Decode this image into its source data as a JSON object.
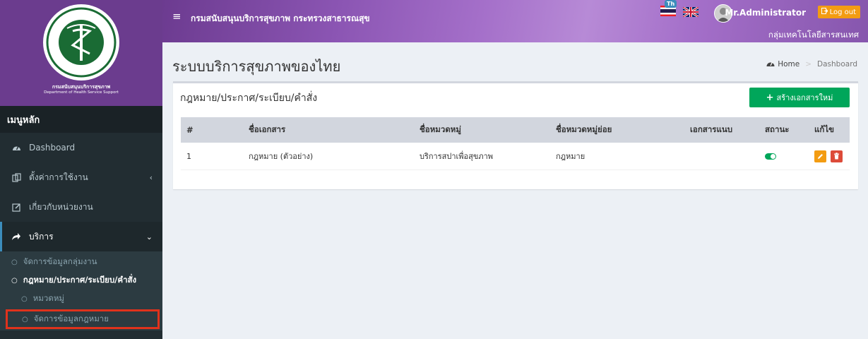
{
  "sidebar": {
    "logo_caption_th": "กรมสนับสนุนบริการสุขภาพ",
    "logo_caption_en": "Department of Health Service Support",
    "menu_header": "เมนูหลัก",
    "items": [
      {
        "label": "Dashboard",
        "icon": "dashboard-icon"
      },
      {
        "label": "ตั้งค่าการใช้งาน",
        "icon": "settings-icon",
        "arrow": "‹"
      },
      {
        "label": "เกี่ยวกับหน่วยงาน",
        "icon": "edit-icon"
      },
      {
        "label": "บริการ",
        "icon": "share-icon",
        "arrow": "⌄"
      }
    ],
    "submenu": [
      {
        "label": "จัดการข้อมูลกลุ่มงาน"
      },
      {
        "label": "กฎหมาย/ประกาศ/ระเบียบ/คำสั่ง"
      },
      {
        "label": "หมวดหมู่"
      },
      {
        "label": "จัดการข้อมูลกฎหมาย"
      }
    ],
    "submenu_bullet": "○"
  },
  "topbar": {
    "menu_toggle": "≡",
    "org_name": "กรมสนับสนุนบริการสุขภาพ กระทรวงสาธารณสุข",
    "lang_badge": "Th",
    "user_name": "Mr.Administrator",
    "logout_label": "Log out",
    "org_unit": "กลุ่มเทคโนโลยีสารสนเทศ"
  },
  "content": {
    "page_title": "ระบบบริการสุขภาพของไทย",
    "breadcrumb": {
      "home": "Home",
      "current": "Dashboard",
      "separator": ">"
    },
    "box_title": "กฎหมาย/ประกาศ/ระเบียบ/คำสั่ง",
    "create_button": "สร้างเอกสารใหม่",
    "table": {
      "headers": [
        "#",
        "ชื่อเอกสาร",
        "ชื่อหมวดหมู่",
        "ชื่อหมวดหมู่ย่อย",
        "เอกสารแนบ",
        "สถานะ",
        "แก้ไข"
      ],
      "rows": [
        {
          "no": "1",
          "name": "กฎหมาย (ตัวอย่าง)",
          "category": "บริการสปาเพื่อสุขภาพ",
          "subcategory": "กฎหมาย",
          "attachment": "",
          "status": "active"
        }
      ]
    }
  },
  "colors": {
    "header_purple": "#8b55b3",
    "sidebar_bg": "#222d32",
    "create_green": "#00a65a",
    "logout_orange": "#f39c12",
    "highlight_red": "#e0321c"
  }
}
